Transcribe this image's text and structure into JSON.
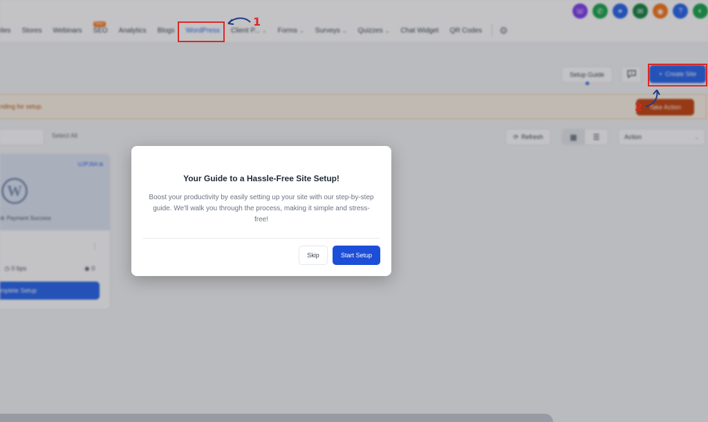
{
  "top_icons": [
    {
      "name": "phone-icon",
      "glyph": "☏",
      "color": "#7c3aed"
    },
    {
      "name": "call-icon",
      "glyph": "✆",
      "color": "#16a34a"
    },
    {
      "name": "link-icon",
      "glyph": "⚭",
      "color": "#2563eb"
    },
    {
      "name": "megaphone-icon",
      "glyph": "✉",
      "color": "#15803d"
    },
    {
      "name": "bell-icon",
      "glyph": "◉",
      "color": "#f97316"
    },
    {
      "name": "help-icon",
      "glyph": "?",
      "color": "#2563eb"
    },
    {
      "name": "avatar-icon",
      "glyph": "◐",
      "color": "#16a34a"
    }
  ],
  "nav": {
    "items": [
      {
        "label": "ites",
        "name": "nav-sites",
        "chevron": false
      },
      {
        "label": "Stores",
        "name": "nav-stores",
        "chevron": false
      },
      {
        "label": "Webinars",
        "name": "nav-webinars",
        "chevron": false
      },
      {
        "label": "SEO",
        "name": "nav-seo",
        "chevron": false,
        "badge": "New"
      },
      {
        "label": "Analytics",
        "name": "nav-analytics",
        "chevron": false
      },
      {
        "label": "Blogs",
        "name": "nav-blogs",
        "chevron": false
      },
      {
        "label": "WordPress",
        "name": "nav-wordpress",
        "chevron": false,
        "active": true
      },
      {
        "label": "Client P...",
        "name": "nav-client-portal",
        "chevron": true
      },
      {
        "label": "Forms",
        "name": "nav-forms",
        "chevron": true
      },
      {
        "label": "Surveys",
        "name": "nav-surveys",
        "chevron": true
      },
      {
        "label": "Quizzes",
        "name": "nav-quizzes",
        "chevron": true
      },
      {
        "label": "Chat Widget",
        "name": "nav-chat-widget",
        "chevron": false
      },
      {
        "label": "QR Codes",
        "name": "nav-qr-codes",
        "chevron": false
      }
    ]
  },
  "header": {
    "setup_guide": "Setup Guide",
    "create_site": "Create Site",
    "create_site_icon": "+"
  },
  "banner": {
    "text": "nding for setup.",
    "action": "Take Action"
  },
  "toolbar": {
    "select_all": "Select All",
    "refresh": "Refresh",
    "action_placeholder": "Action"
  },
  "site_card": {
    "id": "UJPJ6A",
    "logo_letter": "W",
    "payment_status": "Payment Success",
    "bandwidth": "0 bps",
    "views": "0",
    "complete_button": "mplete Setup"
  },
  "modal": {
    "title": "Your Guide to a Hassle-Free Site Setup!",
    "body": "Boost your productivity by easily setting up your site with our step-by-step guide. We'll walk you through the process, making it simple and stress-free!",
    "skip": "Skip",
    "start": "Start Setup"
  },
  "annotations": {
    "step1": "1",
    "step2": "2"
  }
}
